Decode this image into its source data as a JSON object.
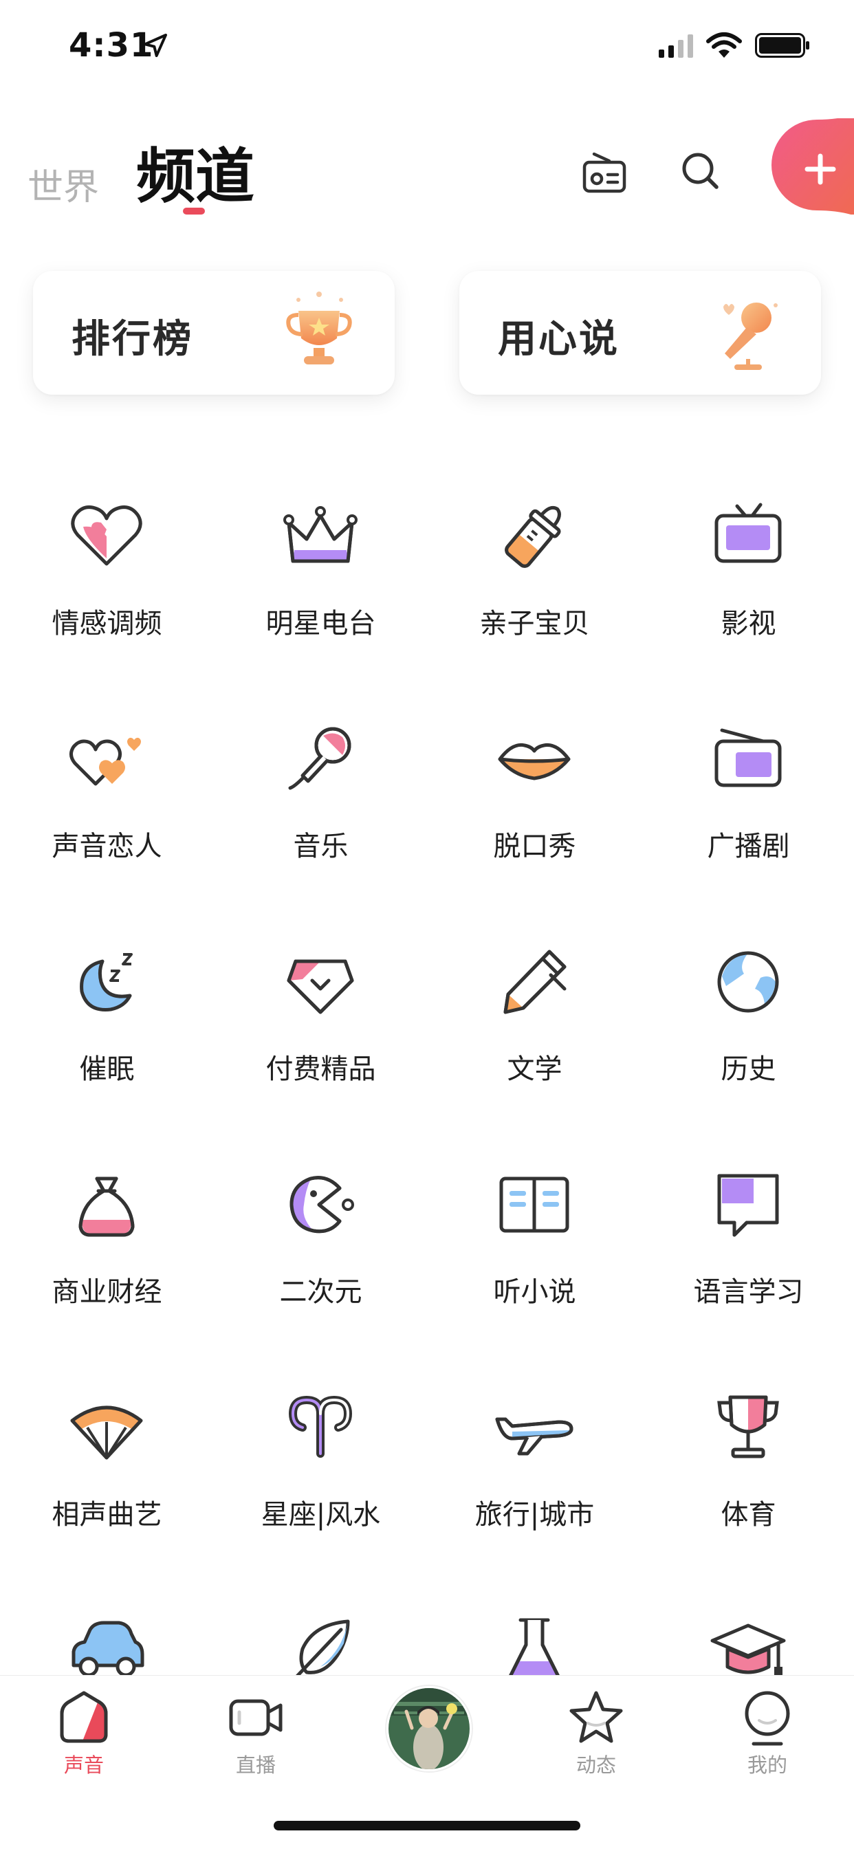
{
  "status": {
    "time": "4:31"
  },
  "header": {
    "tab_world": "世界",
    "tab_channel": "频道"
  },
  "cards": [
    {
      "label": "排行榜",
      "icon": "trophy-icon"
    },
    {
      "label": "用心说",
      "icon": "microphone-icon"
    }
  ],
  "channels": [
    {
      "label": "情感调频",
      "icon": "heart-icon"
    },
    {
      "label": "明星电台",
      "icon": "crown-icon"
    },
    {
      "label": "亲子宝贝",
      "icon": "baby-bottle-icon"
    },
    {
      "label": "影视",
      "icon": "tv-icon"
    },
    {
      "label": "声音恋人",
      "icon": "hearts-icon"
    },
    {
      "label": "音乐",
      "icon": "microphone-icon"
    },
    {
      "label": "脱口秀",
      "icon": "lips-icon"
    },
    {
      "label": "广播剧",
      "icon": "radio-icon"
    },
    {
      "label": "催眠",
      "icon": "moon-sleep-icon"
    },
    {
      "label": "付费精品",
      "icon": "diamond-icon"
    },
    {
      "label": "文学",
      "icon": "pencil-icon"
    },
    {
      "label": "历史",
      "icon": "globe-icon"
    },
    {
      "label": "商业财经",
      "icon": "money-bag-icon"
    },
    {
      "label": "二次元",
      "icon": "pacman-icon"
    },
    {
      "label": "听小说",
      "icon": "book-icon"
    },
    {
      "label": "语言学习",
      "icon": "speech-bubble-icon"
    },
    {
      "label": "相声曲艺",
      "icon": "fan-icon"
    },
    {
      "label": "星座|风水",
      "icon": "aries-icon"
    },
    {
      "label": "旅行|城市",
      "icon": "airplane-icon"
    },
    {
      "label": "体育",
      "icon": "cup-icon"
    },
    {
      "label": "",
      "icon": "car-icon"
    },
    {
      "label": "",
      "icon": "feather-icon"
    },
    {
      "label": "",
      "icon": "flask-icon"
    },
    {
      "label": "",
      "icon": "graduation-cap-icon"
    }
  ],
  "nav": [
    {
      "label": "声音",
      "icon": "home-icon",
      "active": true
    },
    {
      "label": "直播",
      "icon": "video-camera-icon",
      "active": false
    },
    {
      "label": "",
      "icon": "avatar",
      "active": false
    },
    {
      "label": "动态",
      "icon": "star-icon",
      "active": false
    },
    {
      "label": "我的",
      "icon": "profile-icon",
      "active": false
    }
  ],
  "colors": {
    "accent": "#ea4b5b",
    "pink": "#f27e9b",
    "purple": "#b48cf5",
    "orange": "#f7a55d",
    "blue": "#8cc4f4"
  }
}
